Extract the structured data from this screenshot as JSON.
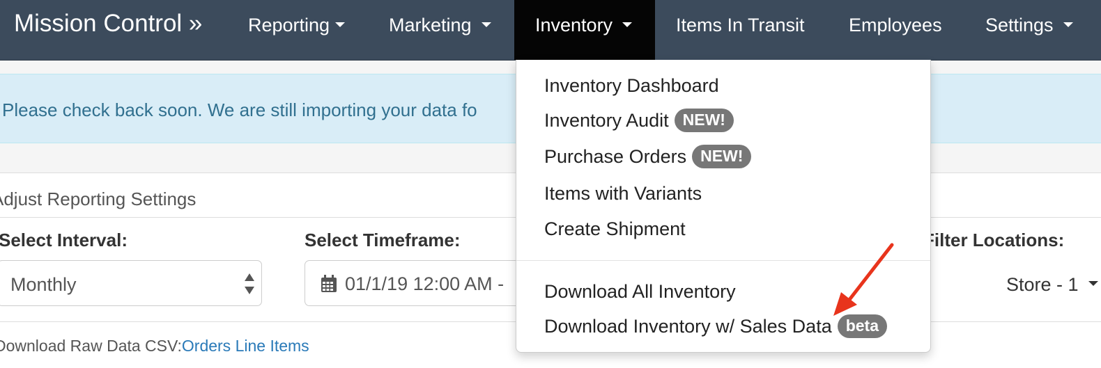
{
  "nav": {
    "brand": "Mission Control »",
    "items": [
      {
        "label": "Reporting",
        "dropdown": true
      },
      {
        "label": "Marketing",
        "dropdown": true
      },
      {
        "label": "Inventory",
        "dropdown": true,
        "active": true
      },
      {
        "label": "Items In Transit",
        "dropdown": false
      },
      {
        "label": "Employees",
        "dropdown": false
      },
      {
        "label": "Settings",
        "dropdown": true
      }
    ]
  },
  "alert": {
    "text": "Please check back soon. We are still importing your data fo"
  },
  "panel": {
    "heading": "Adjust Reporting Settings",
    "interval_label": "Select Interval:",
    "interval_value": "Monthly",
    "timeframe_label": "Select Timeframe:",
    "timeframe_value": "01/1/19 12:00 AM -",
    "locations_label": "Filter Locations:",
    "locations_value": "Store - 1",
    "raw_label": "Download Raw Data CSV:",
    "raw_link": "Orders Line Items"
  },
  "inventory_menu": {
    "items": [
      {
        "label": "Inventory Dashboard",
        "badge": ""
      },
      {
        "label": "Inventory Audit",
        "badge": "NEW!"
      },
      {
        "label": "Purchase Orders",
        "badge": "NEW!"
      },
      {
        "label": "Items with Variants",
        "badge": ""
      },
      {
        "label": "Create Shipment",
        "badge": ""
      },
      {
        "label": "Download All Inventory",
        "badge": ""
      },
      {
        "label": "Download Inventory w/ Sales Data",
        "badge": "beta"
      }
    ]
  },
  "colors": {
    "navbar": "#3c4b5c",
    "nav_active": "#050505",
    "alert_bg": "#d9edf7",
    "alert_text": "#31708f",
    "badge": "#777777",
    "annotation_arrow": "#e8341c",
    "link": "#2a7ab8"
  },
  "icons": {
    "timeframe": "calendar-icon",
    "interval": "select-updown-icon",
    "annotation": "red-arrow-icon"
  }
}
